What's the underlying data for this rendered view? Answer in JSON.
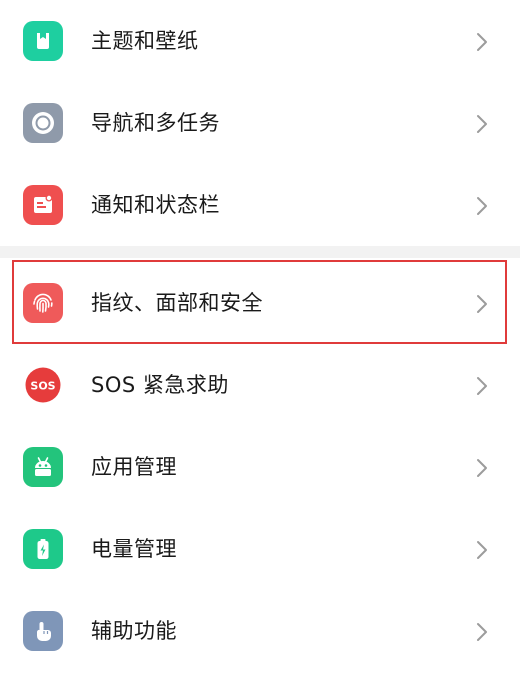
{
  "settings": {
    "items": [
      {
        "label": "主题和壁纸",
        "icon": "theme-icon",
        "color": "#1ecfa0"
      },
      {
        "label": "导航和多任务",
        "icon": "navigation-icon",
        "color": "#8f9aaa"
      },
      {
        "label": "通知和状态栏",
        "icon": "notification-icon",
        "color": "#ef4f4f"
      },
      {
        "label": "指纹、面部和安全",
        "icon": "fingerprint-icon",
        "color": "#ef5a5a"
      },
      {
        "label": "SOS 紧急求助",
        "icon": "sos-icon",
        "color": "#e63c3c",
        "badge": "SOS"
      },
      {
        "label": "应用管理",
        "icon": "android-icon",
        "color": "#23c47c"
      },
      {
        "label": "电量管理",
        "icon": "battery-icon",
        "color": "#1ec98a"
      },
      {
        "label": "辅助功能",
        "icon": "hand-icon",
        "color": "#7f96b8"
      }
    ]
  },
  "highlight_color": "#e03b3b"
}
